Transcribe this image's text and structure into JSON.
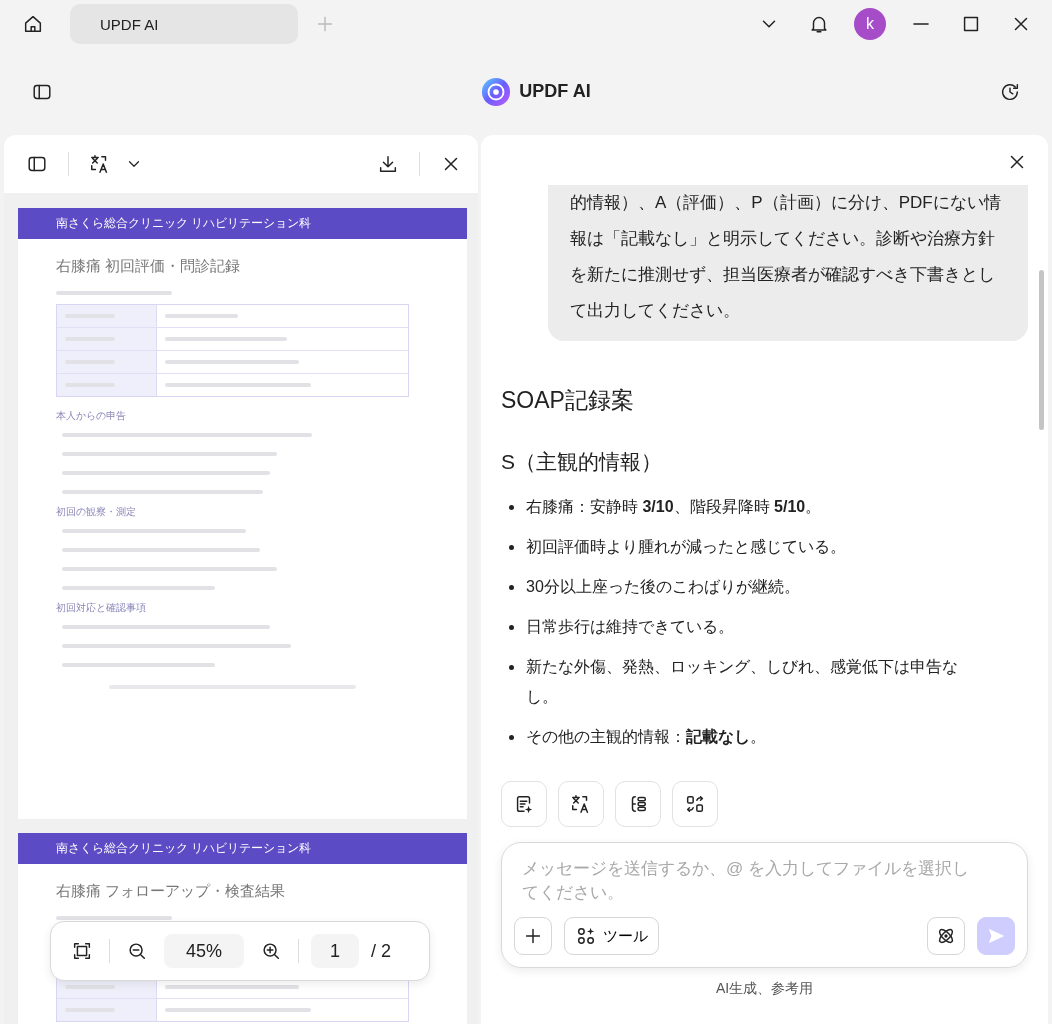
{
  "window": {
    "tab": {
      "label": "UPDF AI",
      "selected": true
    },
    "avatar_letter": "k"
  },
  "header": {
    "title": "UPDF AI"
  },
  "pdf": {
    "pages": [
      {
        "header": "南さくら総合クリニック リハビリテーション科",
        "title": "右膝痛 初回評価・問診記録",
        "sections": [
          "本人からの申告",
          "初回の観察・測定",
          "初回対応と確認事項"
        ]
      },
      {
        "header": "南さくら総合クリニック リハビリテーション科",
        "title": "右膝痛 フォローアップ・検査結果"
      }
    ],
    "zoom": {
      "value": "45%"
    },
    "page": {
      "value": "1",
      "total": "/ 2"
    }
  },
  "chat": {
    "user_message": "的情報）、A（評価）、P（計画）に分け、PDFにない情報は「記載なし」と明示してください。診断や治療方針を新たに推測せず、担当医療者が確認すべき下書きとして出力してください。",
    "answer": {
      "title": "SOAP記録案",
      "section": "S（主観的情報）",
      "bullets": [
        "右膝痛：安静時 **3/10**、階段昇降時 **5/10**。",
        "初回評価時より腫れが減ったと感じている。",
        "30分以上座った後のこわばりが継続。",
        "日常歩行は維持できている。",
        "新たな外傷、発熱、ロッキング、しびれ、感覚低下は申告なし。",
        "その他の主観的情報：**記載なし**。"
      ]
    },
    "input": {
      "placeholder": "メッセージを送信するか、@ を入力してファイルを選択してください。"
    },
    "tools_button": "ツール",
    "footer": "AI生成、参考用"
  }
}
